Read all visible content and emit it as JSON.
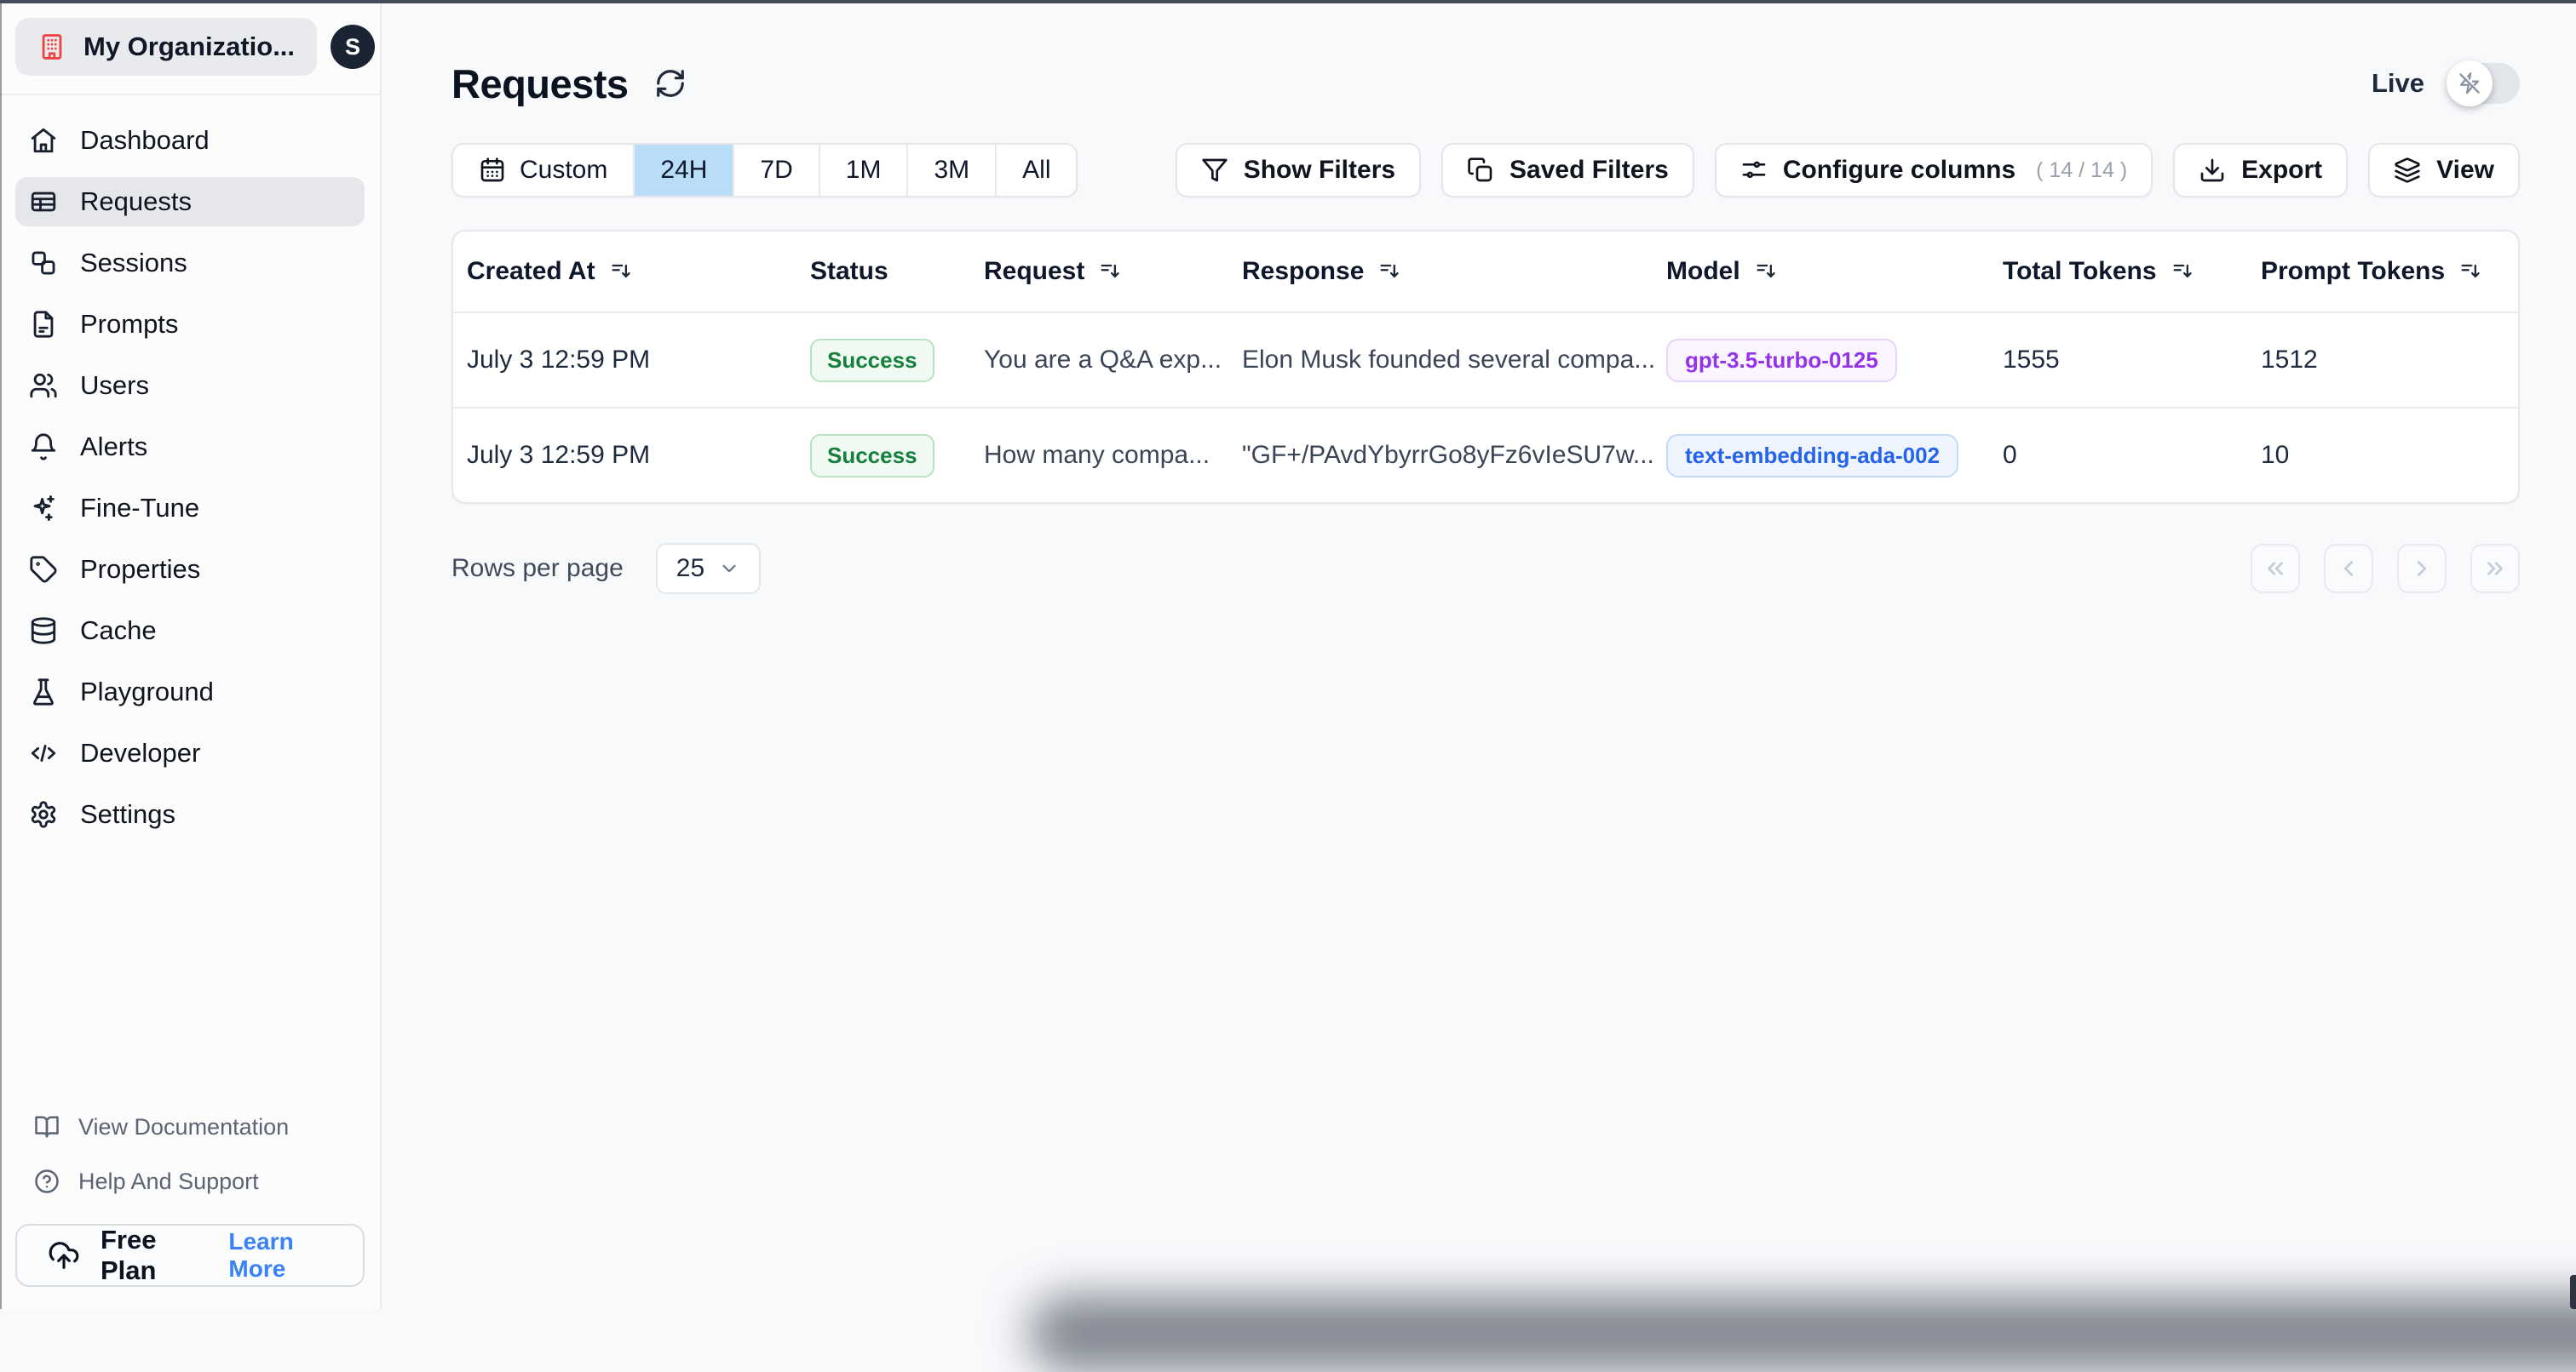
{
  "colors": {
    "selected_range_bg": "#b9dcf7",
    "success_text": "#15803d",
    "model_purple_text": "#9333ea",
    "model_blue_text": "#2563eb",
    "learn_more_link": "#3b82f6",
    "org_icon_red": "#ef4444",
    "avatar_bg": "#1b2433"
  },
  "sidebar": {
    "org_name": "My Organizatio...",
    "avatar_initial": "S",
    "items": [
      {
        "label": "Dashboard"
      },
      {
        "label": "Requests",
        "selected": true
      },
      {
        "label": "Sessions"
      },
      {
        "label": "Prompts"
      },
      {
        "label": "Users"
      },
      {
        "label": "Alerts"
      },
      {
        "label": "Fine-Tune"
      },
      {
        "label": "Properties"
      },
      {
        "label": "Cache"
      },
      {
        "label": "Playground"
      },
      {
        "label": "Developer"
      },
      {
        "label": "Settings"
      }
    ],
    "footer_links": [
      {
        "label": "View Documentation"
      },
      {
        "label": "Help And Support"
      }
    ],
    "plan_badge": {
      "plan": "Free Plan",
      "action": "Learn More"
    }
  },
  "header": {
    "title": "Requests",
    "live_label": "Live"
  },
  "toolbar": {
    "time_ranges": [
      {
        "label": "Custom"
      },
      {
        "label": "24H",
        "selected": true
      },
      {
        "label": "7D"
      },
      {
        "label": "1M"
      },
      {
        "label": "3M"
      },
      {
        "label": "All"
      }
    ],
    "show_filters": "Show Filters",
    "saved_filters": "Saved Filters",
    "configure_columns": "Configure columns",
    "configure_columns_count": "( 14 / 14 )",
    "export": "Export",
    "view": "View"
  },
  "table": {
    "columns": [
      {
        "label": "Created At",
        "sortable": true
      },
      {
        "label": "Status",
        "sortable": false
      },
      {
        "label": "Request",
        "sortable": true
      },
      {
        "label": "Response",
        "sortable": true
      },
      {
        "label": "Model",
        "sortable": true
      },
      {
        "label": "Total Tokens",
        "sortable": true
      },
      {
        "label": "Prompt Tokens",
        "sortable": true
      }
    ],
    "rows": [
      {
        "created_at": "July 3 12:59 PM",
        "status": "Success",
        "request": "You are a Q&A exp...",
        "response": "Elon Musk founded several compa...",
        "model": "gpt-3.5-turbo-0125",
        "total_tokens": "1555",
        "prompt_tokens": "1512"
      },
      {
        "created_at": "July 3 12:59 PM",
        "status": "Success",
        "request": "How many compa...",
        "response": "\"GF+/PAvdYbyrrGo8yFz6vIeSU7w...",
        "model": "text-embedding-ada-002",
        "total_tokens": "0",
        "prompt_tokens": "10"
      }
    ]
  },
  "pagination": {
    "rows_per_page_label": "Rows per page",
    "rows_per_page_value": "25"
  }
}
